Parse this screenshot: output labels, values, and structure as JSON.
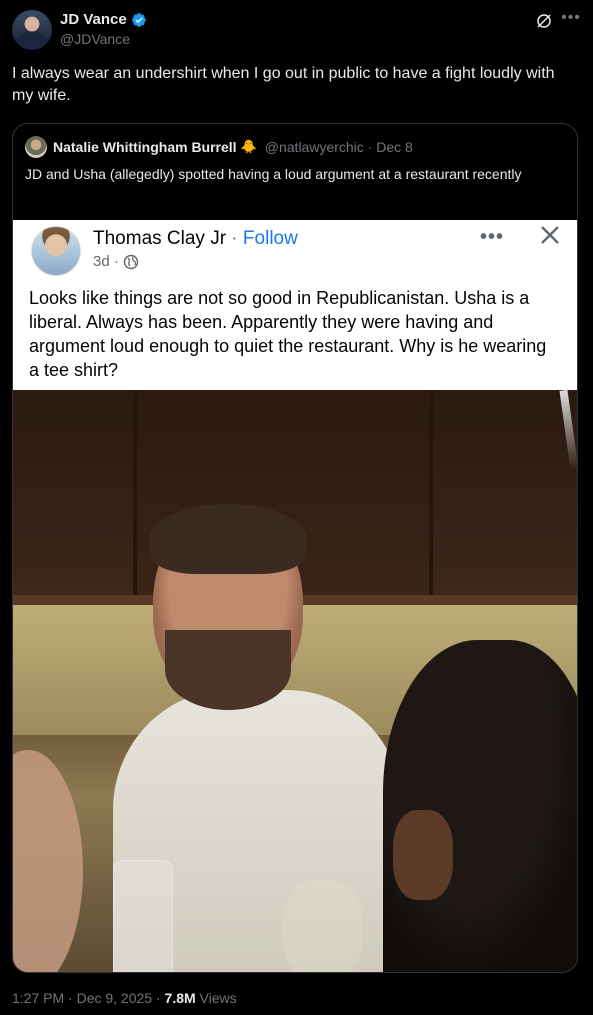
{
  "author": {
    "display_name": "JD Vance",
    "handle": "@JDVance"
  },
  "tweet": {
    "text": "I always wear an undershirt when I go out in public to have a fight loudly with my wife."
  },
  "quote": {
    "display_name": "Natalie Whittingham Burrell",
    "badge": "🐥",
    "handle_date": "@natlawyerchic · Dec 8",
    "text": "JD and Usha (allegedly) spotted having a loud argument at a restaurant recently"
  },
  "fb_post": {
    "name": "Thomas Clay Jr",
    "separator": " · ",
    "follow": "Follow",
    "time": "3d ·",
    "more": "•••",
    "text": "Looks like things are not so good in Republicanistan. Usha is a liberal. Always has been. Apparently they were having and argument loud enough to quiet the restaurant. Why is he wearing a tee shirt?"
  },
  "footer": {
    "time_date": "1:27 PM · Dec 9, 2025 · ",
    "views_count": "7.8M",
    "views_label": " Views"
  },
  "colors": {
    "background": "#000000",
    "text_primary": "#e7e9ea",
    "text_secondary": "#71767b",
    "verified": "#1d9bf0",
    "fb_link": "#1877f2"
  }
}
